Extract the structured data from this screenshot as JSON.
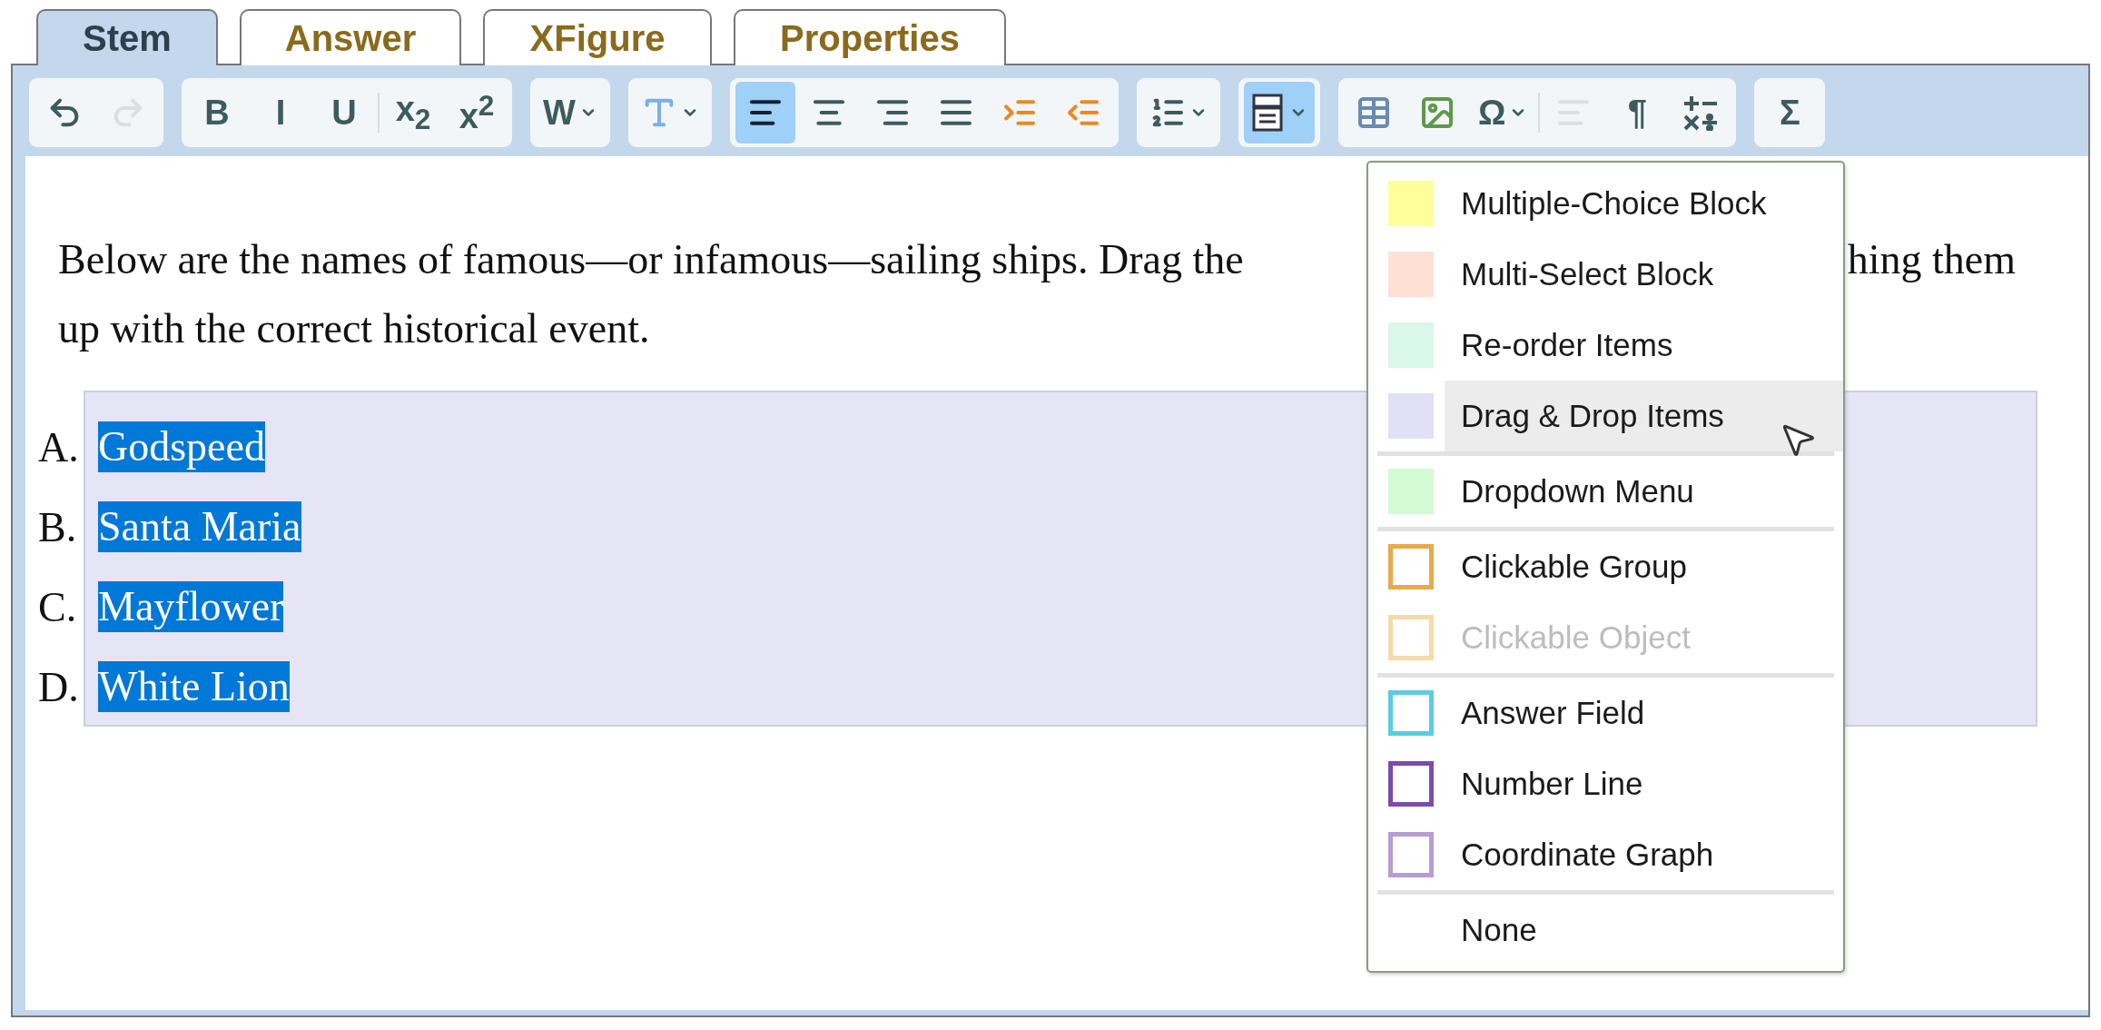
{
  "tabs": [
    {
      "label": "Stem",
      "selected": true
    },
    {
      "label": "Answer",
      "selected": false
    },
    {
      "label": "XFigure",
      "selected": false
    },
    {
      "label": "Properties",
      "selected": false
    }
  ],
  "toolbar": {
    "groups": [
      {
        "buttons": [
          {
            "kind": "undo",
            "active": false,
            "disabled": false
          },
          {
            "kind": "redo",
            "active": false,
            "disabled": true
          }
        ]
      },
      {
        "buttons": [
          {
            "kind": "glyph",
            "text": "B",
            "active": false,
            "disabled": false
          },
          {
            "kind": "glyph",
            "text": "I",
            "active": false,
            "disabled": false
          },
          {
            "kind": "glyph",
            "text": "U",
            "active": false,
            "disabled": false
          },
          {
            "kind": "separator"
          },
          {
            "kind": "glyph",
            "text": "x$_{2}$",
            "active": false,
            "disabled": false
          },
          {
            "kind": "glyph",
            "text": "x$^{2}$",
            "active": false,
            "disabled": false
          }
        ]
      },
      {
        "buttons": [
          {
            "kind": "glyph",
            "text": "W",
            "dropdown": true,
            "active": false,
            "disabled": false
          }
        ]
      },
      {
        "buttons": [
          {
            "kind": "font-color",
            "dropdown": true,
            "active": false,
            "disabled": false
          }
        ]
      },
      {
        "buttons": [
          {
            "kind": "align-left",
            "active": true,
            "disabled": false
          },
          {
            "kind": "align-center",
            "active": false,
            "disabled": false
          },
          {
            "kind": "align-right",
            "active": false,
            "disabled": false
          },
          {
            "kind": "align-justify",
            "active": false,
            "disabled": false
          },
          {
            "kind": "indent",
            "active": false,
            "disabled": false
          },
          {
            "kind": "outdent",
            "active": false,
            "disabled": false
          }
        ]
      },
      {
        "buttons": [
          {
            "kind": "numbered-list",
            "dropdown": true,
            "active": false,
            "disabled": false
          }
        ]
      },
      {
        "buttons": [
          {
            "kind": "insert-block",
            "dropdown": true,
            "active": true,
            "disabled": false
          }
        ]
      },
      {
        "buttons": [
          {
            "kind": "table",
            "active": false,
            "disabled": false
          },
          {
            "kind": "image",
            "active": false,
            "disabled": false
          },
          {
            "kind": "glyph",
            "text": "Ω",
            "dropdown": true,
            "active": false,
            "disabled": false
          },
          {
            "kind": "separator"
          },
          {
            "kind": "text-lines",
            "active": false,
            "disabled": true
          },
          {
            "kind": "glyph",
            "text": "¶",
            "active": false,
            "disabled": false
          },
          {
            "kind": "math-operators",
            "active": false,
            "disabled": false
          }
        ]
      },
      {
        "buttons": [
          {
            "kind": "glyph",
            "text": "Σ",
            "active": false,
            "disabled": false
          }
        ]
      }
    ]
  },
  "stem": {
    "line_1_start": "Below are the names of famous—or infamous—sailing ships. Drag the",
    "line_1_end": "hing them",
    "line_2": "up with the correct historical event.",
    "items": [
      {
        "letter": "A.",
        "text": "Godspeed",
        "selected": true
      },
      {
        "letter": "B.",
        "text": "Santa Maria",
        "selected": true
      },
      {
        "letter": "C.",
        "text": "Mayflower",
        "selected": true
      },
      {
        "letter": "D.",
        "text": "White Lion",
        "selected": true
      }
    ]
  },
  "menu": {
    "groups": [
      {
        "items": [
          {
            "label": "Multiple-Choice Block",
            "kind": "fill",
            "color": "#ffff99",
            "highlighted": false,
            "disabled": false
          },
          {
            "label": "Multi-Select Block",
            "kind": "fill",
            "color": "#ffe0d4",
            "highlighted": false,
            "disabled": false
          },
          {
            "label": "Re-order Items",
            "kind": "fill",
            "color": "#daf7ec",
            "highlighted": false,
            "disabled": false
          },
          {
            "label": "Drag & Drop Items",
            "kind": "fill",
            "color": "#e2e0f6",
            "highlighted": true,
            "disabled": false
          }
        ]
      },
      {
        "items": [
          {
            "label": "Dropdown Menu",
            "kind": "fill",
            "color": "#d3fad3",
            "highlighted": false,
            "disabled": false
          }
        ]
      },
      {
        "items": [
          {
            "label": "Clickable Group",
            "kind": "outline",
            "color": "#e8a94c",
            "highlighted": false,
            "disabled": false
          },
          {
            "label": "Clickable Object",
            "kind": "outline",
            "color": "#f6dbaa",
            "highlighted": false,
            "disabled": true
          }
        ]
      },
      {
        "items": [
          {
            "label": "Answer Field",
            "kind": "outline",
            "color": "#5ccbe3",
            "highlighted": false,
            "disabled": false
          },
          {
            "label": "Number Line",
            "kind": "outline",
            "color": "#7a4cab",
            "highlighted": false,
            "disabled": false
          },
          {
            "label": "Coordinate Graph",
            "kind": "outline",
            "color": "#b79dd3",
            "highlighted": false,
            "disabled": false
          }
        ]
      },
      {
        "items": [
          {
            "label": "None",
            "kind": "none",
            "highlighted": false,
            "disabled": false
          }
        ]
      }
    ]
  }
}
